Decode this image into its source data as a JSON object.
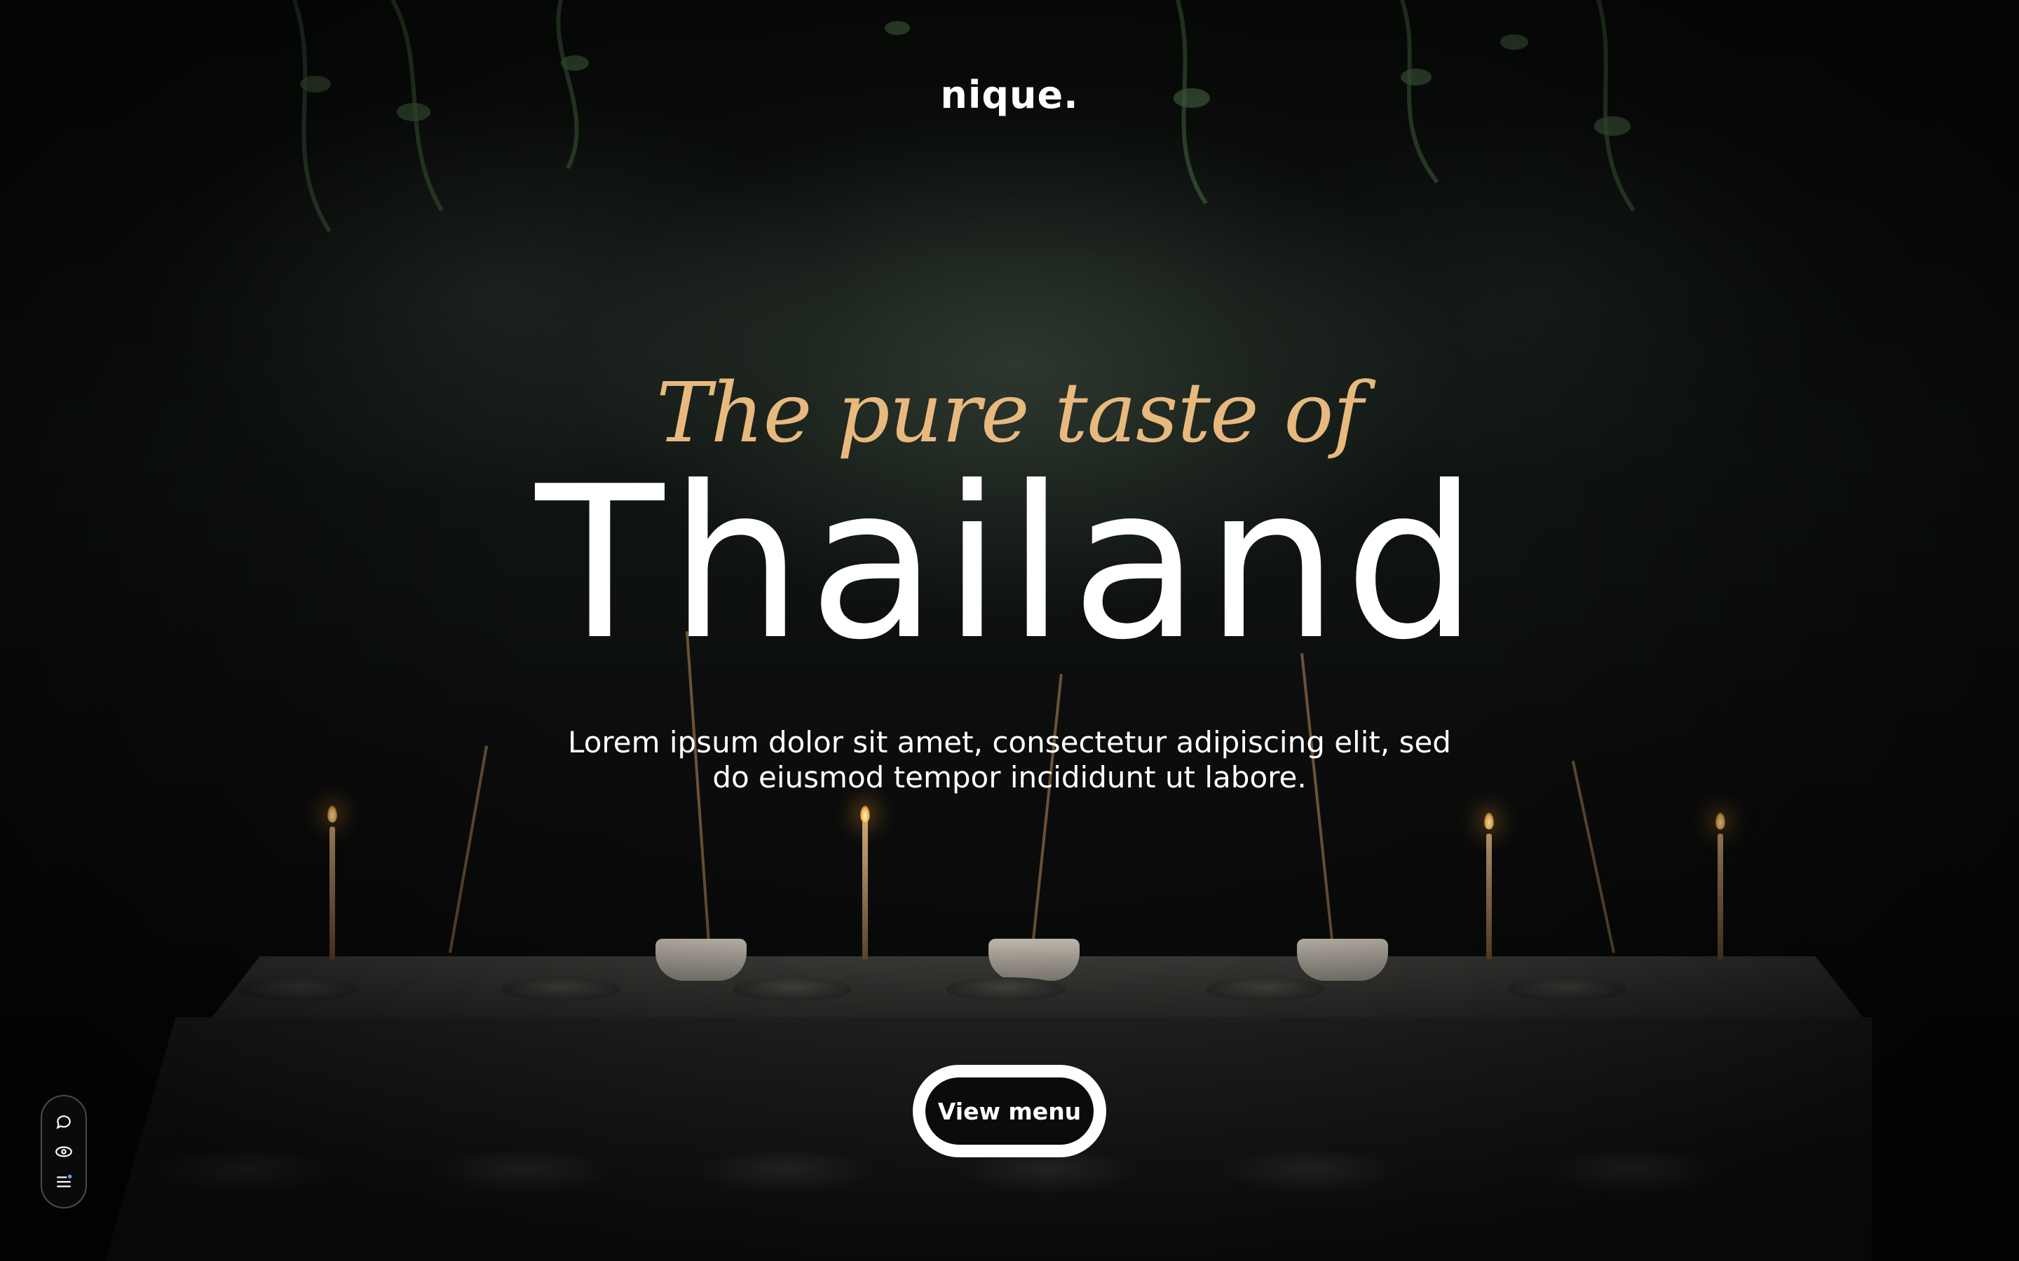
{
  "site": {
    "logo": "nique."
  },
  "hero": {
    "tagline": "The pure taste of",
    "headline": "Thailand",
    "description": "Lorem ipsum dolor sit amet, consectetur adipiscing elit, sed do eiusmod tempor incididunt ut labore.",
    "cta_label": "View menu"
  },
  "side_tools": {
    "items": [
      "chat-icon",
      "eye-icon",
      "menu-list-icon"
    ]
  },
  "colors": {
    "accent": "#e8b97e",
    "text": "#ffffff",
    "background": "#050505"
  }
}
